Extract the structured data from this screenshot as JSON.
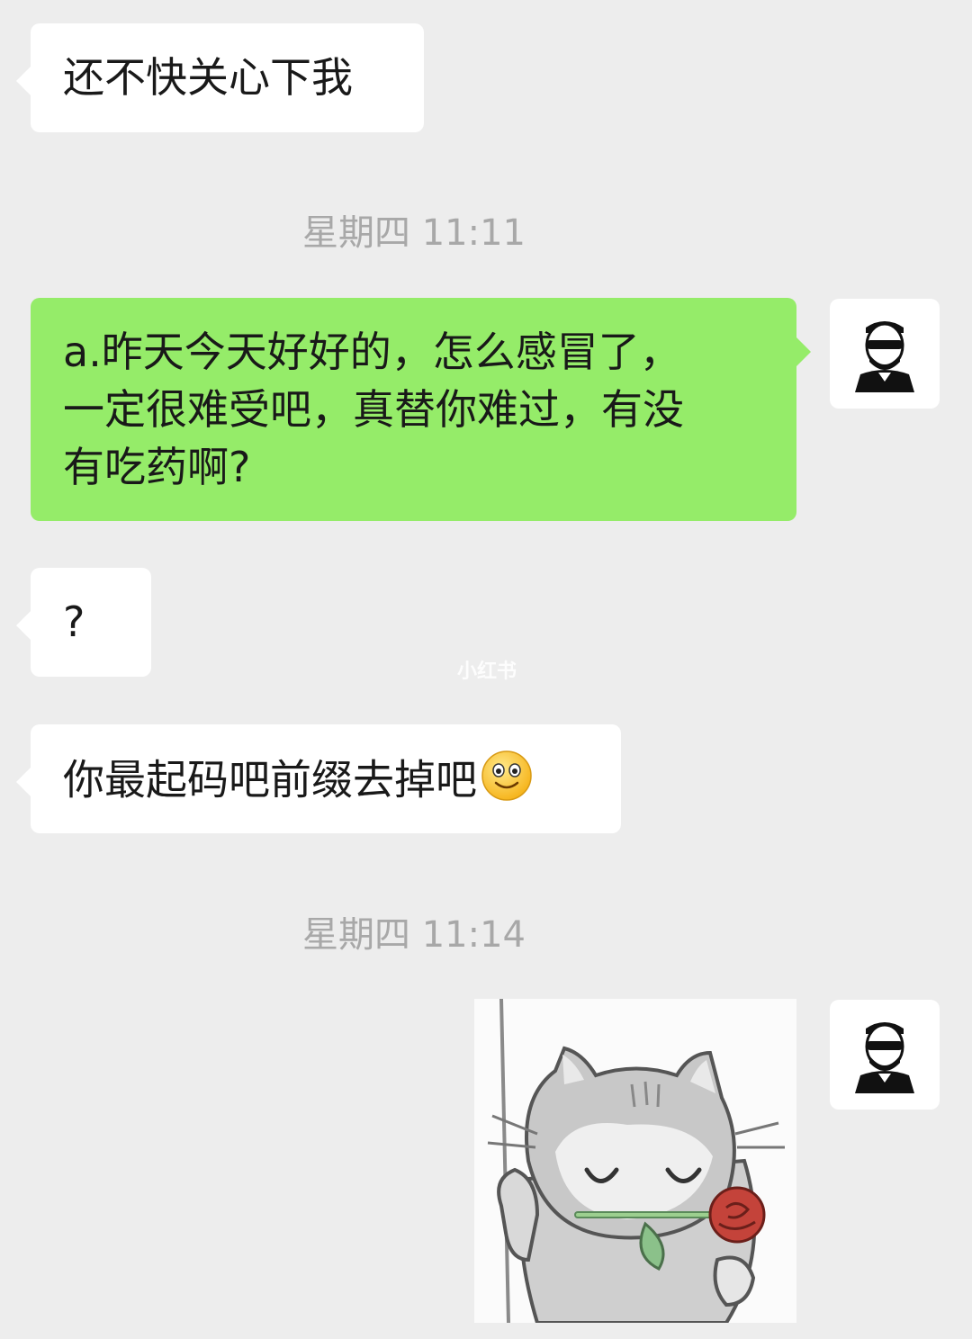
{
  "messages": [
    {
      "side": "in",
      "text": "还不快关心下我"
    },
    {
      "side": "out",
      "lines": [
        "a.昨天今天好好的，怎么感冒了，",
        "一定很难受吧，真替你难过，有没",
        "有吃药啊?"
      ]
    },
    {
      "side": "in",
      "text": "?"
    },
    {
      "side": "in",
      "text": "你最起码吧前缀去掉吧"
    }
  ],
  "timestamps": [
    "星期四 11:11",
    "星期四 11:14"
  ],
  "watermark": "小红书",
  "icons": {
    "avatar": "man-sunglasses-avatar-icon",
    "emoji": "smile-emoji-icon",
    "sticker": "cat-with-rose-sticker"
  },
  "colors": {
    "background": "#ededed",
    "incoming_bubble": "#ffffff",
    "outgoing_bubble": "#95ec69",
    "timestamp": "#a8a8a8"
  }
}
